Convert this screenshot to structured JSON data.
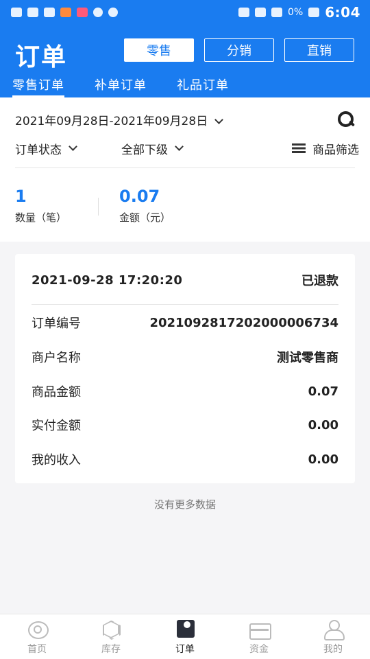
{
  "status_bar": {
    "time": "6:04",
    "battery": "0%",
    "accent": "#1a7cf0"
  },
  "header": {
    "title": "订单",
    "modes": [
      {
        "label": "零售",
        "active": true
      },
      {
        "label": "分销",
        "active": false
      },
      {
        "label": "直销",
        "active": false
      }
    ],
    "subtabs": [
      {
        "label": "零售订单",
        "active": true
      },
      {
        "label": "补单订单",
        "active": false
      },
      {
        "label": "礼品订单",
        "active": false
      }
    ]
  },
  "filters": {
    "date_range": "2021年09月28日-2021年09月28日",
    "order_status": "订单状态",
    "subordinate": "全部下级",
    "goods_filter": "商品筛选"
  },
  "stats": {
    "count_value": "1",
    "count_label": "数量（笔）",
    "amount_value": "0.07",
    "amount_label": "金额（元）"
  },
  "order": {
    "datetime": "2021-09-28  17:20:20",
    "status": "已退款",
    "rows": [
      {
        "key": "订单编号",
        "value": "20210928172020000067​34"
      },
      {
        "key": "商户名称",
        "value": "测试零售商"
      },
      {
        "key": "商品金额",
        "value": "0.07"
      },
      {
        "key": "实付金额",
        "value": "0.00"
      },
      {
        "key": "我的收入",
        "value": "0.00"
      }
    ]
  },
  "footer_text": "没有更多数据",
  "tabbar": [
    {
      "label": "首页",
      "icon": "home-icon",
      "active": false
    },
    {
      "label": "库存",
      "icon": "stock-icon",
      "active": false
    },
    {
      "label": "订单",
      "icon": "order-icon",
      "active": true
    },
    {
      "label": "资金",
      "icon": "wallet-icon",
      "active": false
    },
    {
      "label": "我的",
      "icon": "profile-icon",
      "active": false
    }
  ]
}
